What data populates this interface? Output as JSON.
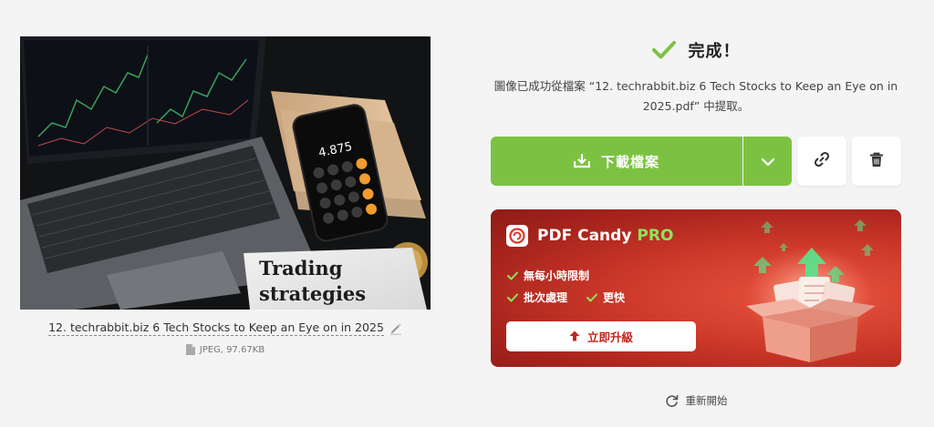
{
  "preview": {
    "image_text": [
      "Trading",
      "strategies"
    ],
    "calculator_display": "4.875"
  },
  "file": {
    "name": "12. techrabbit.biz 6 Tech Stocks to Keep an Eye on in 2025",
    "meta": "JPEG, 97.67KB"
  },
  "status": {
    "title": "完成！",
    "message": "圖像已成功從檔案 “12. techrabbit.biz 6 Tech Stocks to Keep an Eye on in 2025.pdf” 中提取。"
  },
  "actions": {
    "download_label": "下載檔案"
  },
  "pro": {
    "brand": "PDF Candy",
    "tag": "PRO",
    "features": [
      "無每小時限制",
      "批次處理",
      "更快"
    ],
    "upgrade_label": "立即升級"
  },
  "restart_label": "重新開始",
  "colors": {
    "accent_green": "#7cc242",
    "pro_red": "#cf3a2a",
    "pro_tag_green": "#8fe35a"
  }
}
